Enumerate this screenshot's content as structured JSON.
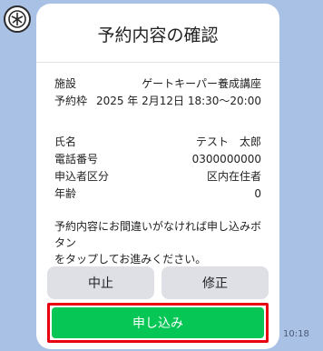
{
  "dialog": {
    "title": "予約内容の確認"
  },
  "booking": {
    "rows": [
      {
        "label": "施設",
        "value": "ゲートキーパー養成講座"
      },
      {
        "label": "予約枠",
        "value": "2025 年 2月12日 18:30〜20:00"
      }
    ]
  },
  "applicant": {
    "rows": [
      {
        "label": "氏名",
        "value": "テスト　太郎"
      },
      {
        "label": "電話番号",
        "value": "0300000000"
      },
      {
        "label": "申込者区分",
        "value": "区内在住者"
      },
      {
        "label": "年齢",
        "value": "0"
      }
    ]
  },
  "notice": {
    "line1": "予約内容にお間違いがなければ申し込みボタン",
    "line2": "をタップしてお進みください。"
  },
  "buttons": {
    "cancel": "中止",
    "edit": "修正",
    "apply": "申し込み"
  },
  "message": {
    "time": "10:18"
  },
  "colors": {
    "background": "#aac1e6",
    "apply_button": "#06c755",
    "highlight": "#e60012"
  }
}
